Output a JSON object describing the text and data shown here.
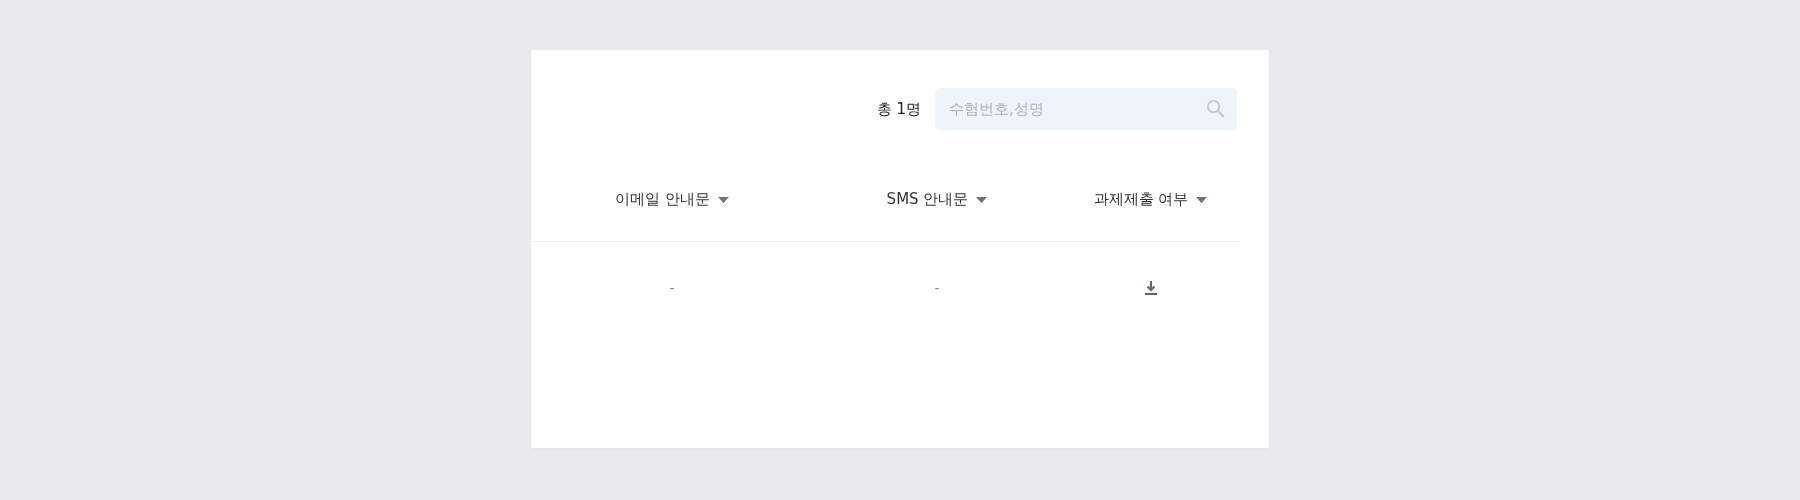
{
  "summary": {
    "count": "총 1명"
  },
  "search": {
    "placeholder": "수험번호,성명"
  },
  "table": {
    "columns": [
      {
        "label": "이메일 안내문"
      },
      {
        "label": "SMS 안내문"
      },
      {
        "label": "과제제출 여부"
      }
    ],
    "rows": [
      {
        "cells": [
          {
            "kind": "text",
            "text": "-"
          },
          {
            "kind": "text",
            "text": "-"
          },
          {
            "kind": "download"
          }
        ]
      }
    ]
  }
}
